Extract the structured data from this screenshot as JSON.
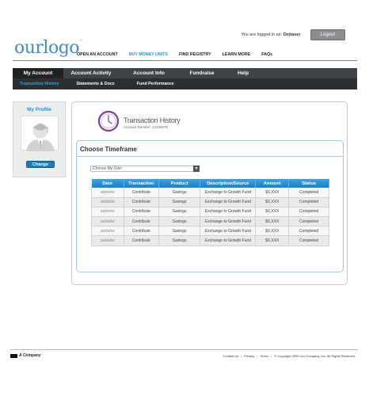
{
  "topbar": {
    "logged_in_text": "You are logged in as:",
    "user": "Debaser",
    "logout_label": "Logout"
  },
  "logo": {
    "text": "ourlogo",
    "tm": "™"
  },
  "main_nav": [
    {
      "label": "OPEN AN ACCOUNT",
      "active": false
    },
    {
      "label": "BUY MONEY UNITS",
      "active": true
    },
    {
      "label": "FIND REGISTRY",
      "active": false
    },
    {
      "label": "LEARN MORE",
      "active": false
    },
    {
      "label": "FAQs",
      "active": false
    }
  ],
  "tabs": [
    {
      "label": "My Account",
      "active": true
    },
    {
      "label": "Account Activity",
      "active": false
    },
    {
      "label": "Account Info",
      "active": false
    },
    {
      "label": "Fundraise",
      "active": false
    },
    {
      "label": "Help",
      "active": false
    }
  ],
  "subtabs": [
    {
      "label": "Transaction History",
      "active": true
    },
    {
      "label": "Statements & Docs",
      "active": false
    },
    {
      "label": "Fund Performance",
      "active": false
    }
  ],
  "profile": {
    "title": "My Profile",
    "change_label": "Change"
  },
  "transaction": {
    "title": "Transaction History",
    "account_number": "Account Number: 12345678"
  },
  "timeframe": {
    "heading": "Choose Timeframe",
    "select_value": "Choose My Own"
  },
  "table": {
    "headers": [
      "Date",
      "Transaction",
      "Product",
      "Description/Source",
      "Amount",
      "Status"
    ],
    "rows": [
      [
        "xx/xx/xx",
        "Contribute",
        "Savings",
        "Exchange to Growth Fund",
        "$X,XXX",
        "Completed"
      ],
      [
        "xx/xx/xx",
        "Contribute",
        "Savings",
        "Exchange to Growth Fund",
        "$X,XXX",
        "Completed"
      ],
      [
        "xx/xx/xx",
        "Contribute",
        "Savings",
        "Exchange to Growth Fund",
        "$X,XXX",
        "Completed"
      ],
      [
        "xx/xx/xx",
        "Contribute",
        "Savings",
        "Exchange to Growth Fund",
        "$X,XXX",
        "Completed"
      ],
      [
        "xx/xx/xx",
        "Contribute",
        "Savings",
        "Exchange to Growth Fund",
        "$X,XXX",
        "Completed"
      ],
      [
        "xx/xx/xx",
        "Contribute",
        "Savings",
        "Exchange to Growth Fund",
        "$X,XXX",
        "Completed"
      ]
    ]
  },
  "footer": {
    "company": "A Company",
    "links": [
      "Contact Us",
      "Privacy",
      "Terms",
      "© Copyright 2009 Xxx Company, Inc. All Rights Reserved."
    ]
  },
  "colors": {
    "accent": "#2f8fc8",
    "nav_dark": "#3e4347",
    "table_header": "#1b80c9",
    "clock": "#7a3f92"
  }
}
